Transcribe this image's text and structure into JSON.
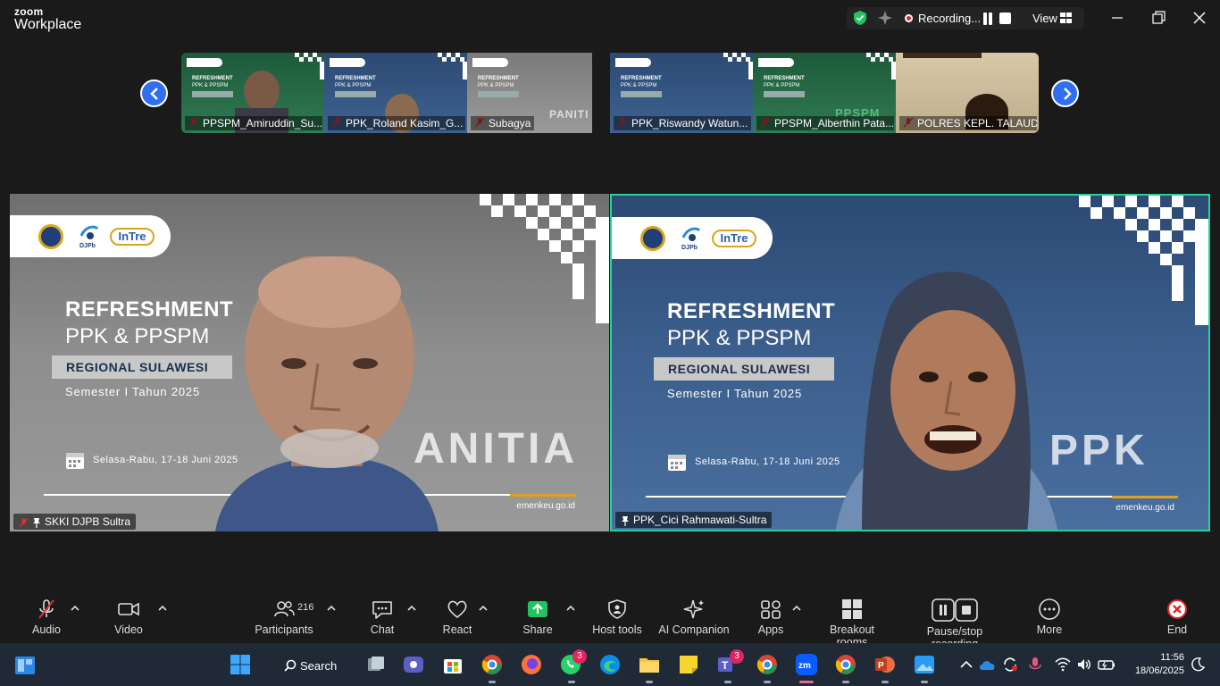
{
  "app": {
    "brand_top": "zoom",
    "brand_bottom": "Workplace"
  },
  "titlebar": {
    "recording_label": "Recording...",
    "view_label": "View"
  },
  "filmstrip": [
    {
      "name": "PPSPM_Amiruddin_Su...",
      "muted": true,
      "bg": "#1e5a3a"
    },
    {
      "name": "PPK_Roland Kasim_G...",
      "muted": true,
      "bg": "#2c4a73"
    },
    {
      "name": "Subagya",
      "muted": true,
      "bg": "#7a7a7a"
    },
    {
      "name": "PPK_Riswandy Watun...",
      "muted": true,
      "bg": "#2c4a73"
    },
    {
      "name": "PPSPM_Alberthin Pata...",
      "muted": true,
      "bg": "#1e5a3a"
    },
    {
      "name": "POLRES KEPL. TALAUD",
      "muted": true,
      "bg": "#c8b89a"
    }
  ],
  "slide": {
    "title1": "REFRESHMENT",
    "title2": "PPK & PPSPM",
    "region": "REGIONAL SULAWESI",
    "semester": "Semester I Tahun 2025",
    "date": "Selasa-Rabu, 17-18 Juni 2025",
    "site": "emenkeu.go.id",
    "djpb": "DJPb",
    "intress": "InTre"
  },
  "tiles": [
    {
      "name": "SKKI DJPB Sultra",
      "watermark": "ANITIA",
      "muted": true,
      "active_speaker": false
    },
    {
      "name": "PPK_Cici Rahmawati-Sultra",
      "watermark": "PPK",
      "muted": false,
      "active_speaker": true
    }
  ],
  "controls": {
    "audio": "Audio",
    "video": "Video",
    "participants": "Participants",
    "participants_count": "216",
    "chat": "Chat",
    "react": "React",
    "share": "Share",
    "host_tools": "Host tools",
    "ai_companion": "AI Companion",
    "apps": "Apps",
    "breakout_rooms": "Breakout rooms",
    "pause_stop_recording": "Pause/stop recording",
    "more": "More",
    "end": "End"
  },
  "taskbar": {
    "search_label": "Search",
    "whatsapp_badge": "3",
    "teams_badge": "3",
    "time": "11:56",
    "date": "18/06/2025"
  },
  "colors": {
    "accent": "#2f6ff0",
    "active_border": "#25d39a",
    "end_red": "#e02828"
  }
}
